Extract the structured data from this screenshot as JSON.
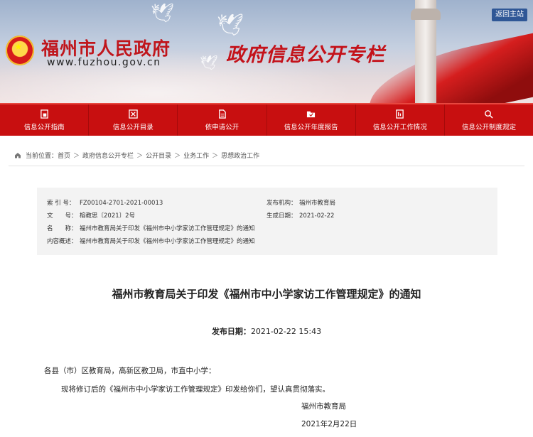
{
  "header": {
    "gov_title": "福州市人民政府",
    "gov_url": "www.fuzhou.gov.cn",
    "special_title": "政府信息公开专栏",
    "back_home": "返回主站"
  },
  "nav": {
    "items": [
      {
        "label": "信息公开指南",
        "icon": "guide-icon"
      },
      {
        "label": "信息公开目录",
        "icon": "catalog-icon"
      },
      {
        "label": "依申请公开",
        "icon": "document-icon"
      },
      {
        "label": "信息公开年度报告",
        "icon": "folder-icon"
      },
      {
        "label": "信息公开工作情况",
        "icon": "report-icon"
      },
      {
        "label": "信息公开制度规定",
        "icon": "search-icon"
      }
    ]
  },
  "breadcrumb": {
    "prefix": "当前位置：",
    "items": [
      "首页",
      "政府信息公开专栏",
      "公开目录",
      "业务工作",
      "思想政治工作"
    ],
    "separator": "＞"
  },
  "info": {
    "index_label": "索 引 号：",
    "index_value": "FZ00104-2701-2021-00013",
    "publisher_label": "发布机构：",
    "publisher_value": "福州市教育局",
    "doc_no_label": "文　　号：",
    "doc_no_value": "榕教思〔2021〕2号",
    "date_label": "生成日期：",
    "date_value": "2021-02-22",
    "name_label": "名　　称：",
    "name_value": "福州市教育局关于印发《福州市中小学家访工作管理规定》的通知",
    "summary_label": "内容概述：",
    "summary_value": "福州市教育局关于印发《福州市中小学家访工作管理规定》的通知"
  },
  "article": {
    "title": "福州市教育局关于印发《福州市中小学家访工作管理规定》的通知",
    "publish_label": "发布日期：",
    "publish_value": "2021-02-22 15:43",
    "salutation": "各县（市）区教育局，高新区教卫局，市直中小学：",
    "body": "现将修订后的《福州市中小学家访工作管理规定》印发给你们，望认真贯彻落实。",
    "signature": "福州市教育局",
    "sign_date": "2021年2月22日"
  },
  "colors": {
    "nav_red": "#c80f10",
    "title_red": "#c0161c",
    "back_home_blue": "#2f5796",
    "info_bg": "#f3f3f3"
  }
}
